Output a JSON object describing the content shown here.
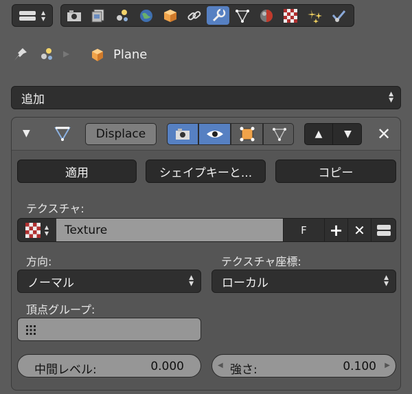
{
  "colors": {
    "panel": "#5b5b5b",
    "widget": "#2f2f2f",
    "active": "#5680c2",
    "text": "#e6e6e6"
  },
  "header": {
    "tabs": [
      "render",
      "render-layers",
      "scene",
      "world",
      "object",
      "constraints",
      "modifiers",
      "data",
      "material",
      "texture",
      "particles",
      "physics"
    ],
    "active_tab": "modifiers"
  },
  "breadcrumb": {
    "object_name": "Plane"
  },
  "add_modifier": {
    "label": "追加"
  },
  "modifier": {
    "name": "Displace",
    "buttons": {
      "apply": "適用",
      "shape_key": "シェイプキーと...",
      "copy": "コピー"
    },
    "texture_label": "テクスチャ:",
    "texture_name": "Texture",
    "fake_user": "F",
    "direction_label": "方向:",
    "direction_value": "ノーマル",
    "tex_coords_label": "テクスチャ座標:",
    "tex_coords_value": "ローカル",
    "vertex_group_label": "頂点グループ:",
    "midlevel_label": "中間レベル:",
    "midlevel_value": "0.000",
    "strength_label": "強さ:",
    "strength_value": "0.100"
  }
}
